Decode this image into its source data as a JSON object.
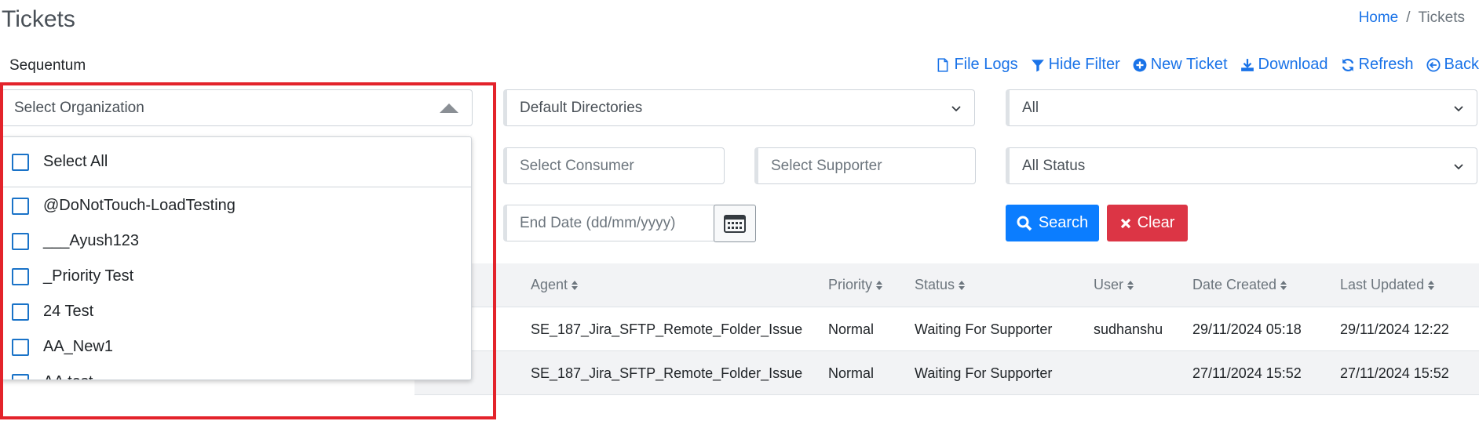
{
  "page": {
    "title": "Tickets"
  },
  "breadcrumb": {
    "home": "Home",
    "separator": "/",
    "current": "Tickets"
  },
  "organization_label": "Sequentum",
  "toolbar": {
    "file_logs": "File Logs",
    "hide_filter": "Hide Filter",
    "new_ticket": "New Ticket",
    "download": "Download",
    "refresh": "Refresh",
    "back": "Back"
  },
  "filters": {
    "organization": "Select Organization",
    "directories": "Default Directories",
    "scope": "All",
    "consumer_placeholder": "Select Consumer",
    "supporter_placeholder": "Select Supporter",
    "status": "All Status",
    "end_date_placeholder": "End Date (dd/mm/yyyy)"
  },
  "buttons": {
    "search": "Search",
    "clear": "Clear"
  },
  "dropdown": {
    "select_all": "Select All",
    "items": [
      "@DoNotTouch-LoadTesting",
      "___Ayush123",
      "_Priority Test",
      "24 Test",
      "AA_New1",
      "AA test"
    ]
  },
  "table": {
    "columns": [
      "Agent",
      "Priority",
      "Status",
      "User",
      "Date Created",
      "Last Updated"
    ],
    "rows": [
      [
        "SE_187_Jira_SFTP_Remote_Folder_Issue",
        "Normal",
        "Waiting For Supporter",
        "sudhanshu",
        "29/11/2024 05:18",
        "29/11/2024 12:22"
      ],
      [
        "SE_187_Jira_SFTP_Remote_Folder_Issue",
        "Normal",
        "Waiting For Supporter",
        "",
        "27/11/2024 15:52",
        "27/11/2024 15:52"
      ]
    ]
  },
  "colors": {
    "link": "#1a73e8",
    "primary": "#0b7dff",
    "danger": "#dc3545",
    "highlight_frame": "#e3232b"
  },
  "icons": [
    "file-icon",
    "filter-icon",
    "plus-circle-icon",
    "download-icon",
    "refresh-icon",
    "back-circle-icon",
    "calendar-icon",
    "search-icon",
    "x-icon",
    "sort-icon",
    "chevron-down-icon",
    "caret-up-icon"
  ]
}
